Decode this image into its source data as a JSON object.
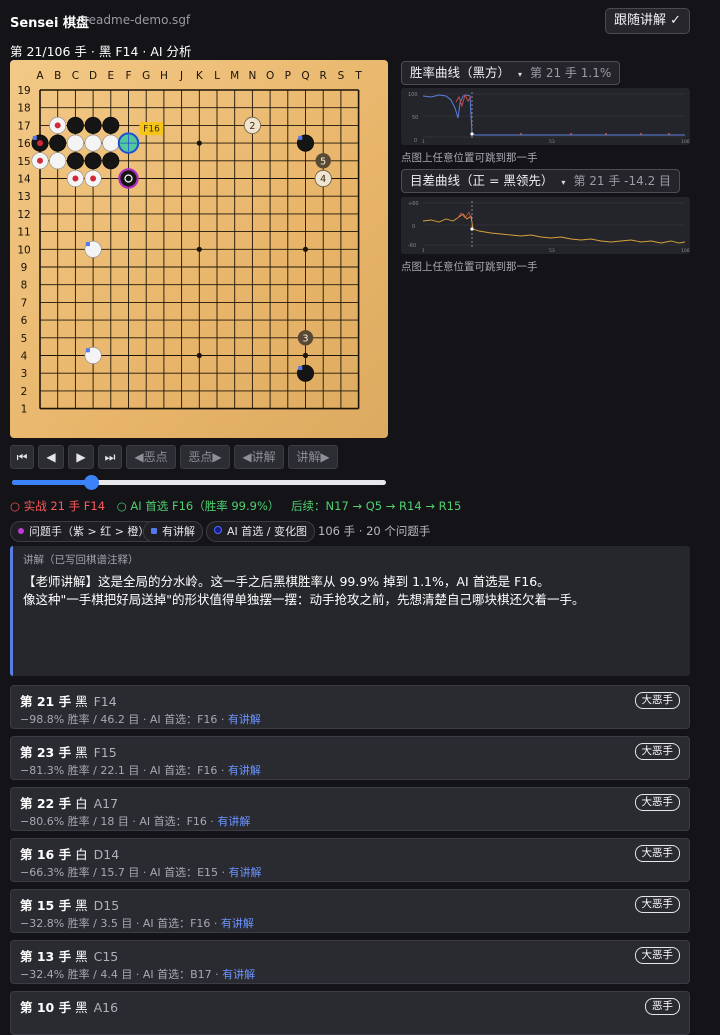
{
  "header": {
    "title": "Sensei 棋盘",
    "file": "readme-demo.sgf",
    "follow_button": "跟随讲解 ✓"
  },
  "move_info": "第 21/106 手 · 黑 F14 · AI 分析",
  "board": {
    "col_labels": [
      "A",
      "B",
      "C",
      "D",
      "E",
      "F",
      "G",
      "H",
      "J",
      "K",
      "L",
      "M",
      "N",
      "O",
      "P",
      "Q",
      "R",
      "S",
      "T"
    ],
    "row_labels": [
      "19",
      "18",
      "17",
      "16",
      "15",
      "14",
      "13",
      "12",
      "11",
      "10",
      "9",
      "8",
      "7",
      "6",
      "5",
      "4",
      "3",
      "2",
      "1"
    ],
    "stones": [
      {
        "color": "black",
        "pt": "C17"
      },
      {
        "color": "black",
        "pt": "D17"
      },
      {
        "color": "black",
        "pt": "E17"
      },
      {
        "color": "black",
        "pt": "A16"
      },
      {
        "color": "black",
        "pt": "B16"
      },
      {
        "color": "black",
        "pt": "C15"
      },
      {
        "color": "black",
        "pt": "D15"
      },
      {
        "color": "black",
        "pt": "E15"
      },
      {
        "color": "black",
        "pt": "Q16"
      },
      {
        "color": "black",
        "pt": "Q3"
      },
      {
        "color": "white",
        "pt": "B17"
      },
      {
        "color": "white",
        "pt": "A15"
      },
      {
        "color": "white",
        "pt": "B15"
      },
      {
        "color": "white",
        "pt": "C16"
      },
      {
        "color": "white",
        "pt": "D16"
      },
      {
        "color": "white",
        "pt": "E16"
      },
      {
        "color": "white",
        "pt": "C14"
      },
      {
        "color": "white",
        "pt": "D14"
      },
      {
        "color": "white",
        "pt": "D10"
      },
      {
        "color": "white",
        "pt": "D4"
      }
    ],
    "hoshi": [
      "D16",
      "K16",
      "Q16",
      "D10",
      "K10",
      "Q10",
      "D4",
      "K4",
      "Q4"
    ],
    "ai_best": "F16",
    "ai_best_label": "F16",
    "current": "F14",
    "variations": [
      {
        "pt": "N17",
        "n": "2",
        "kind": "white"
      },
      {
        "pt": "R15",
        "n": "5",
        "kind": "dark"
      },
      {
        "pt": "R14",
        "n": "4",
        "kind": "white"
      },
      {
        "pt": "Q5",
        "n": "3",
        "kind": "dark"
      }
    ],
    "problem_marks": [
      "B17",
      "A15",
      "C14",
      "D14",
      "A16"
    ],
    "comment_marks": [
      "Q16",
      "Q3",
      "D10",
      "D4",
      "A16"
    ]
  },
  "winrate_panel": {
    "selector": "胜率曲线（黑方）",
    "readout": "第 21 手 1.1%",
    "hint": "点图上任意位置可跳到那一手"
  },
  "score_panel": {
    "selector": "目差曲线（正 = 黑领先）",
    "readout": "第 21 手 -14.2 目",
    "hint": "点图上任意位置可跳到那一手"
  },
  "controls": {
    "first": "⏮",
    "prev": "◀",
    "next": "▶",
    "last": "⏭",
    "prev_mistake": "◀恶点",
    "next_mistake": "恶点▶",
    "prev_comment": "◀讲解",
    "next_comment": "讲解▶"
  },
  "slider": {
    "value": 21,
    "max": 106
  },
  "status": {
    "actual": "○ 实战 21 手 F14",
    "ai": "○ AI 首选 F16（胜率 99.9%）",
    "followup": "后续：N17 → Q5 → R14 → R15"
  },
  "legend": {
    "problem": "问题手（紫 > 红 > 橙）",
    "commented": "有讲解",
    "ai_pick": "AI 首选 / 变化图",
    "count": "106 手 · 20 个问题手"
  },
  "comment": {
    "title": "讲解（已写回棋谱注释）",
    "line1": "【老师讲解】这是全局的分水岭。这一手之后黑棋胜率从 99.9% 掉到 1.1%，AI 首选是 F16。",
    "line2": "像这种\"一手棋把好局送掉\"的形状值得单独摆一摆：动手抢攻之前，先想清楚自己哪块棋还欠着一手。"
  },
  "mistakes": [
    {
      "move": "第 21 手",
      "color": "黑",
      "coord": "F14",
      "detail": "−98.8% 胜率 / 46.2 目 · AI 首选：F16 · ",
      "link": "有讲解",
      "badge": "大恶手"
    },
    {
      "move": "第 23 手",
      "color": "黑",
      "coord": "F15",
      "detail": "−81.3% 胜率 / 22.1 目 · AI 首选：F16 · ",
      "link": "有讲解",
      "badge": "大恶手"
    },
    {
      "move": "第 22 手",
      "color": "白",
      "coord": "A17",
      "detail": "−80.6% 胜率 / 18 目 · AI 首选：F16 · ",
      "link": "有讲解",
      "badge": "大恶手"
    },
    {
      "move": "第 16 手",
      "color": "白",
      "coord": "D14",
      "detail": "−66.3% 胜率 / 15.7 目 · AI 首选：E15 · ",
      "link": "有讲解",
      "badge": "大恶手"
    },
    {
      "move": "第 15 手",
      "color": "黑",
      "coord": "D15",
      "detail": "−32.8% 胜率 / 3.5 目 · AI 首选：F16 · ",
      "link": "有讲解",
      "badge": "大恶手"
    },
    {
      "move": "第 13 手",
      "color": "黑",
      "coord": "C15",
      "detail": "−32.4% 胜率 / 4.4 目 · AI 首选：B17 · ",
      "link": "有讲解",
      "badge": "大恶手"
    },
    {
      "move": "第 10 手",
      "color": "黑",
      "coord": "A16",
      "detail": "",
      "link": "",
      "badge": "恶手"
    }
  ],
  "colors": {
    "accent": "#3b82f6",
    "bad": "#ff5a5a",
    "good": "#4fd16f",
    "problem_dot": "#c03bd6",
    "comment_square": "#5577ee"
  }
}
